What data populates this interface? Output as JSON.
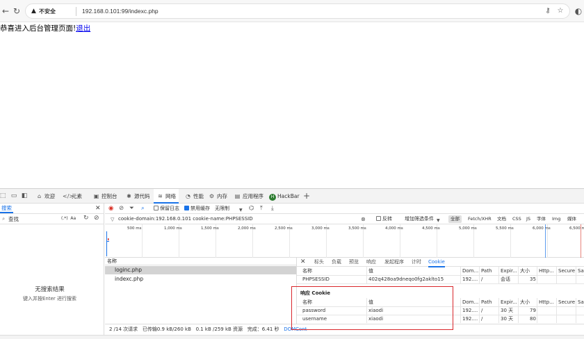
{
  "browser": {
    "security_label": "不安全",
    "url": "192.168.0.101:99/indexc.php"
  },
  "page": {
    "message": "恭喜进入后台管理页面!",
    "logout_link": "退出"
  },
  "devtools": {
    "tabs": [
      {
        "label": "欢迎",
        "icon": "home-icon"
      },
      {
        "label": "元素",
        "icon": "code-icon"
      },
      {
        "label": "控制台",
        "icon": "console-icon"
      },
      {
        "label": "源代码",
        "icon": "bug-icon"
      },
      {
        "label": "网络",
        "icon": "wifi-icon"
      },
      {
        "label": "性能",
        "icon": "gauge-icon"
      },
      {
        "label": "内存",
        "icon": "memory-icon"
      },
      {
        "label": "应用程序",
        "icon": "app-icon"
      },
      {
        "label": "HackBar",
        "icon": "hackbar-icon"
      }
    ],
    "search_panel": {
      "title": "搜索",
      "find_placeholder": "查找",
      "flag_regex": "(.*)",
      "flag_case": "Aa",
      "empty_title": "无搜索结果",
      "empty_hint": "键入并按Enter 进行搜索"
    },
    "network": {
      "toolbar": {
        "preserve_log": "保留日志",
        "disable_cache": "禁用缓存",
        "throttle": "无限制"
      },
      "filter": {
        "value": "cookie-domain:192.168.0.101 cookie-name:PHPSESSID",
        "invert": "反转",
        "more_filters": "增加筛选条件",
        "types": [
          "全部",
          "Fetch/XHR",
          "文档",
          "CSS",
          "JS",
          "字体",
          "Img",
          "媒体"
        ]
      },
      "timeline_ticks": [
        "500 ms",
        "1,000 ms",
        "1,500 ms",
        "2,000 ms",
        "2,500 ms",
        "3,000 ms",
        "3,500 ms",
        "4,000 ms",
        "4,500 ms",
        "5,000 ms",
        "5,500 ms",
        "6,000 ms",
        "6,500 ms"
      ],
      "request_header": "名称",
      "requests": [
        "loginc.php",
        "indexc.php"
      ],
      "status": {
        "requests": "2 /14 次请求",
        "transferred": "已传输0.9 kB/260 kB",
        "resources": "0.1 kB /259 kB 资源",
        "finish": "完成：6.41 秒",
        "domcontent": "DOMCont"
      }
    },
    "detail": {
      "tabs": [
        "标头",
        "负载",
        "预览",
        "响应",
        "发起程序",
        "计时",
        "Cookie"
      ],
      "columns": [
        "名称",
        "值",
        "Dom...",
        "Path",
        "Expir...",
        "大小",
        "Http...",
        "Secure",
        "Sa"
      ],
      "request_cookies": [
        {
          "name": "PHPSESSID",
          "value": "402q428oa9dneqo0fg2aklto15",
          "domain": "192....",
          "path": "/",
          "expires": "会话",
          "size": "35"
        }
      ],
      "response_cookies_title": "响应 Cookie",
      "response_cookies": [
        {
          "name": "password",
          "value": "xiaodi",
          "domain": "192....",
          "path": "/",
          "expires": "30 天",
          "size": "79"
        },
        {
          "name": "username",
          "value": "xiaodi",
          "domain": "192....",
          "path": "/",
          "expires": "30 天",
          "size": "80"
        }
      ]
    }
  }
}
